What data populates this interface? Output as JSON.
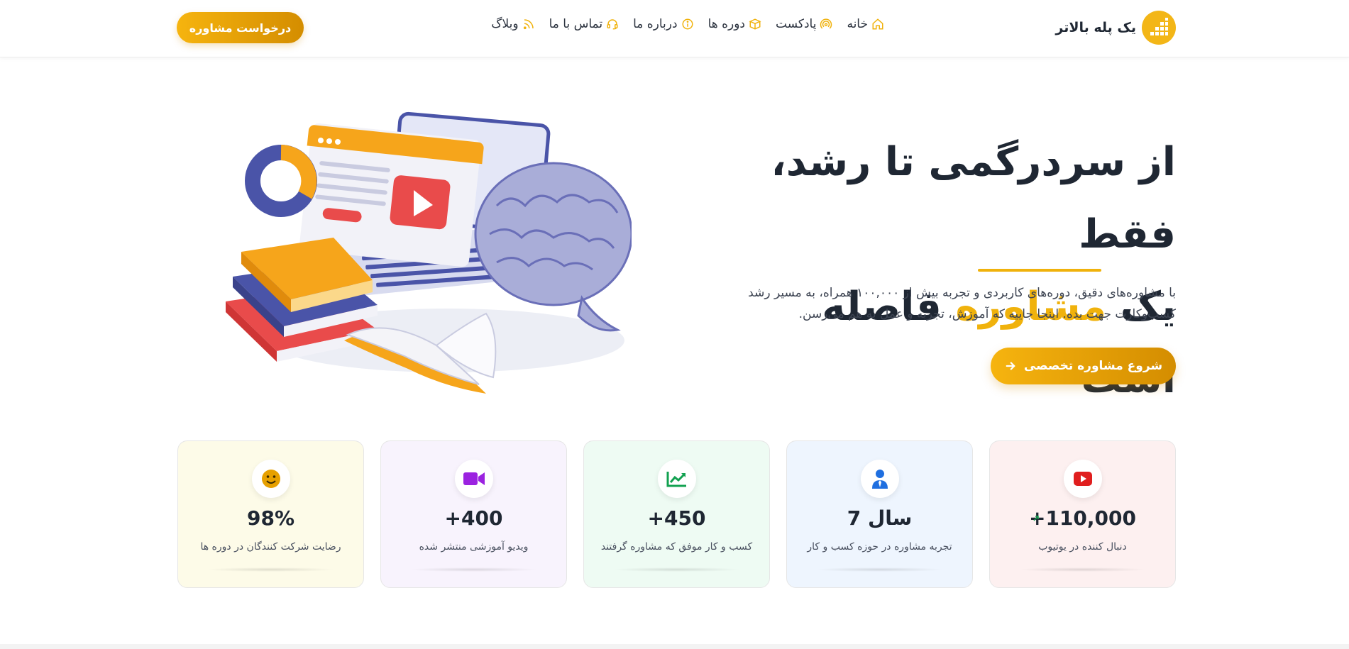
{
  "header": {
    "brand_name": "یک پله بالاتر",
    "nav": [
      {
        "label": "خانه",
        "icon": "home-icon"
      },
      {
        "label": "پادکست",
        "icon": "podcast-icon"
      },
      {
        "label": "دوره ها",
        "icon": "box-icon"
      },
      {
        "label": "درباره ما",
        "icon": "info-icon"
      },
      {
        "label": "تماس با ما",
        "icon": "headset-icon"
      },
      {
        "label": "وبلاگ",
        "icon": "rss-icon"
      }
    ],
    "cta_label": "درخواست مشاوره"
  },
  "hero": {
    "title_line1": "از سردرگمی تا رشد، فقط",
    "title_line2_prefix": "یک",
    "title_line2_accent": "مشاوره",
    "title_line2_suffix": "فاصله است",
    "description": "با مشاوره‌های دقیق، دوره‌های کاربردی و تجربه بیش از ۱۰۰,۰۰۰ همراه، به مسیر رشد کسب‌وکارت جهت بده. اینجا جاییه که آموزش، تجربه و عمل به هم می‌رسن.",
    "cta_label": "شروع مشاوره تخصصی",
    "accent_color": "#f0b20c"
  },
  "stats": [
    {
      "value": "+110,000",
      "label": "دنبال کننده در یوتیوب",
      "icon": "youtube-icon",
      "bg": "#fdf0f0",
      "icon_color": "#e01e1e"
    },
    {
      "value": "7 سال",
      "label": "تجربه مشاوره در حوزه کسب و کار",
      "icon": "user-tie-icon",
      "bg": "#eef5fe",
      "icon_color": "#1f6fe0"
    },
    {
      "value": "+450",
      "label": "کسب و کار موفق که مشاوره گرفتند",
      "icon": "chart-up-icon",
      "bg": "#eefbf3",
      "icon_color": "#12a150"
    },
    {
      "value": "+400",
      "label": "ویدیو آموزشی منتشر شده",
      "icon": "video-camera-icon",
      "bg": "#f8f3fd",
      "icon_color": "#9b22e0"
    },
    {
      "value": "98%",
      "label": "رضایت شرکت کنندگان در دوره ها",
      "icon": "smile-icon",
      "bg": "#fdfbe8",
      "icon_color": "#e6a000"
    }
  ]
}
